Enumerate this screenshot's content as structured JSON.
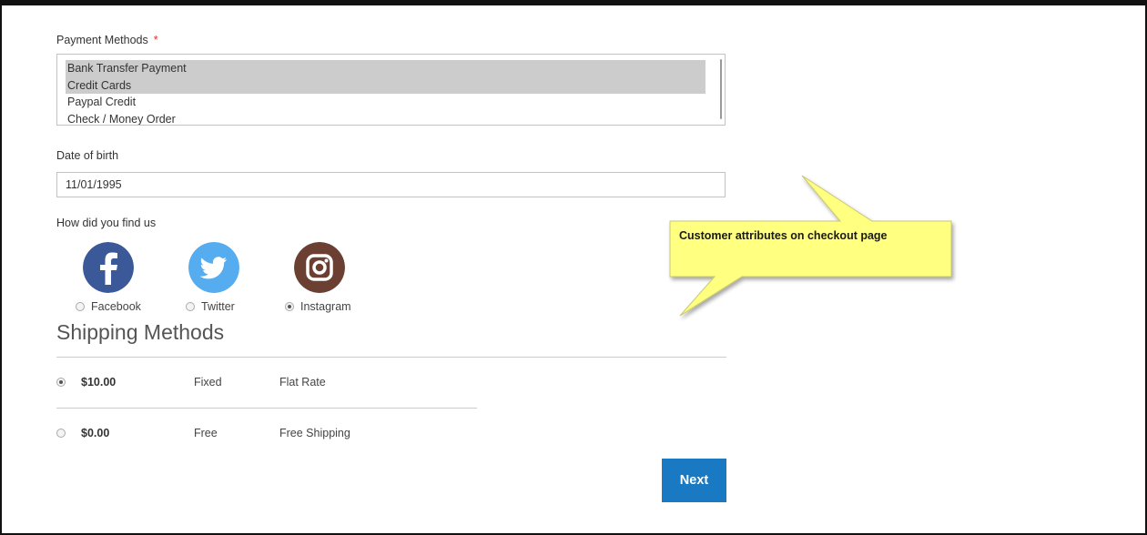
{
  "payment": {
    "label": "Payment Methods",
    "required_mark": "*",
    "options": [
      {
        "label": "Bank Transfer Payment",
        "selected": true
      },
      {
        "label": "Credit Cards",
        "selected": true
      },
      {
        "label": "Paypal Credit",
        "selected": false
      },
      {
        "label": "Check / Money Order",
        "selected": false
      }
    ]
  },
  "dob": {
    "label": "Date of birth",
    "value": "11/01/1995"
  },
  "find_us": {
    "label": "How did you find us",
    "options": [
      {
        "label": "Facebook",
        "icon": "facebook-icon",
        "color": "#3b5998",
        "checked": false
      },
      {
        "label": "Twitter",
        "icon": "twitter-icon",
        "color": "#55acee",
        "checked": false
      },
      {
        "label": "Instagram",
        "icon": "instagram-icon",
        "color": "#6b4033",
        "checked": true
      }
    ]
  },
  "shipping": {
    "heading": "Shipping Methods",
    "rows": [
      {
        "price": "$10.00",
        "method": "Fixed",
        "carrier": "Flat Rate",
        "checked": true
      },
      {
        "price": "$0.00",
        "method": "Free",
        "carrier": "Free Shipping",
        "checked": false
      }
    ]
  },
  "actions": {
    "next_label": "Next",
    "accent": "#1979c3"
  },
  "callout": {
    "text": "Customer attributes on checkout page",
    "color": "#ffff80"
  }
}
